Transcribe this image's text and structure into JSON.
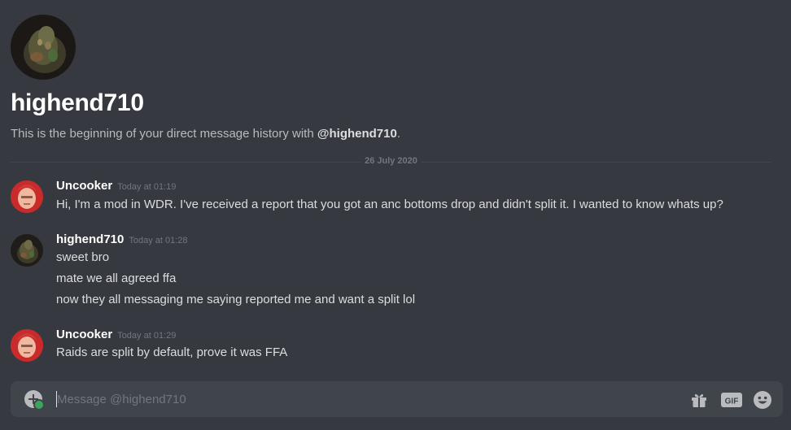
{
  "intro": {
    "name": "highend710",
    "sub_prefix": "This is the beginning of your direct message history with ",
    "sub_handle": "@highend710",
    "sub_suffix": "."
  },
  "divider": {
    "date": "26 July 2020"
  },
  "messages": [
    {
      "author": "Uncooker",
      "time": "Today at 01:19",
      "lines": [
        "Hi, I'm a mod in WDR. I've received a report that you got an anc bottoms drop and didn't split it. I wanted to know whats up?"
      ]
    },
    {
      "author": "highend710",
      "time": "Today at 01:28",
      "lines": [
        "sweet bro",
        "mate we all agreed ffa",
        "now they all messaging me saying reported me and want a split lol"
      ]
    },
    {
      "author": "Uncooker",
      "time": "Today at 01:29",
      "lines": [
        "Raids are split by default, prove it was FFA"
      ]
    }
  ],
  "composer": {
    "placeholder": "Message @highend710",
    "gif_label": "GIF"
  },
  "icons": {
    "upload": "plus-circle-icon",
    "gift": "gift-icon",
    "gif": "gif-icon",
    "emoji": "smiley-face-icon"
  },
  "colors": {
    "background": "#36393f",
    "composer": "#40444b",
    "muted": "#72767d",
    "text": "#dcddde",
    "green": "#3ba55c"
  }
}
